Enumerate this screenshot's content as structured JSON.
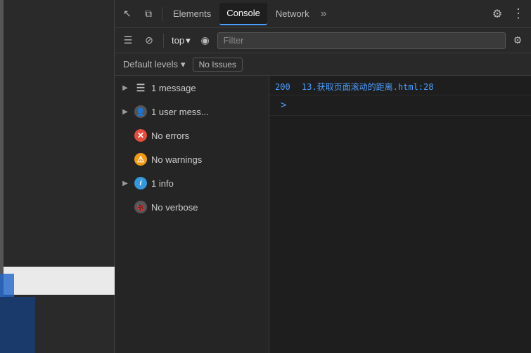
{
  "webpage": {
    "label": "webpage background"
  },
  "toolbar": {
    "cursor_icon": "↖",
    "layers_icon": "⧉",
    "elements_label": "Elements",
    "console_label": "Console",
    "network_label": "Network",
    "more_icon": "»",
    "gear_icon": "⚙",
    "dots_icon": "⋮"
  },
  "console_toolbar": {
    "sidebar_icon": "☰",
    "ban_icon": "⊘",
    "top_label": "top",
    "dropdown_icon": "▾",
    "eye_icon": "◉",
    "filter_placeholder": "Filter",
    "settings_icon": "⚙"
  },
  "levels_toolbar": {
    "default_levels_label": "Default levels",
    "dropdown_icon": "▾",
    "no_issues_label": "No Issues"
  },
  "messages": [
    {
      "id": "1-message",
      "expand": "▶",
      "icon_type": "list",
      "icon_text": "☰",
      "label": "1 message",
      "active": false
    },
    {
      "id": "1-user-mess",
      "expand": "▶",
      "icon_type": "user",
      "icon_text": "👤",
      "label": "1 user mess...",
      "active": false
    },
    {
      "id": "no-errors",
      "expand": "",
      "icon_type": "error",
      "icon_text": "✕",
      "label": "No errors",
      "active": false
    },
    {
      "id": "no-warnings",
      "expand": "",
      "icon_type": "warning",
      "icon_text": "⚠",
      "label": "No warnings",
      "active": false
    },
    {
      "id": "1-info",
      "expand": "▶",
      "icon_type": "info",
      "icon_text": "i",
      "label": "1 info",
      "active": false
    },
    {
      "id": "no-verbose",
      "expand": "",
      "icon_type": "verbose",
      "icon_text": "🐞",
      "label": "No verbose",
      "active": false
    }
  ],
  "console_output": {
    "status_code": "200",
    "file_link": "13.获取页面滚动的距离.html:28",
    "prompt_symbol": ">"
  }
}
